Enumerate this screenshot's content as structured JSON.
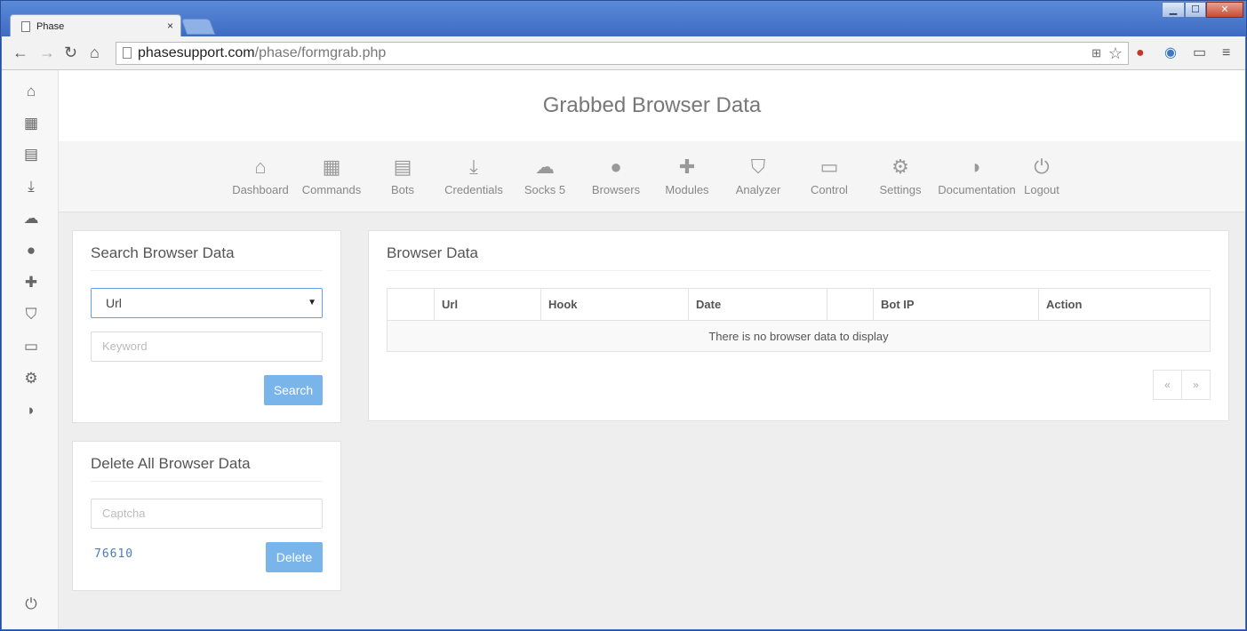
{
  "browser": {
    "tab_title": "Phase",
    "tab_close": "×",
    "window_buttons": {
      "minimize": "▁",
      "maximize": "☐",
      "close": "✕"
    },
    "url_domain": "phasesupport.com",
    "url_path": "/phase/formgrab.php",
    "nav_icons": [
      "back-icon",
      "forward-icon",
      "reload-icon",
      "home-icon"
    ],
    "toolbar_icons": [
      "translate-icon",
      "star-icon",
      "extension-cookie-icon",
      "extension-globe-icon",
      "cast-icon",
      "menu-icon"
    ]
  },
  "header": {
    "title": "Grabbed Browser Data"
  },
  "nav": {
    "items": [
      {
        "label": "Dashboard",
        "icon": "home-icon"
      },
      {
        "label": "Commands",
        "icon": "calendar-icon"
      },
      {
        "label": "Bots",
        "icon": "grid-icon"
      },
      {
        "label": "Credentials",
        "icon": "download-icon"
      },
      {
        "label": "Socks 5",
        "icon": "cloud-icon"
      },
      {
        "label": "Browsers",
        "icon": "globe-icon"
      },
      {
        "label": "Modules",
        "icon": "puzzle-icon"
      },
      {
        "label": "Analyzer",
        "icon": "shield-icon"
      },
      {
        "label": "Control",
        "icon": "monitor-icon"
      },
      {
        "label": "Settings",
        "icon": "gears-icon"
      },
      {
        "label": "Documentation",
        "icon": "chat-icon"
      },
      {
        "label": "Logout",
        "icon": "power-icon"
      }
    ]
  },
  "sidebar": {
    "icons": [
      "home-icon",
      "calendar-icon",
      "grid-icon",
      "download-icon",
      "cloud-icon",
      "globe-icon",
      "puzzle-icon",
      "shield-icon",
      "monitor-icon",
      "gears-icon",
      "chat-icon"
    ],
    "bottom_icon": "power-icon"
  },
  "search_panel": {
    "title": "Search Browser Data",
    "select_value": "Url",
    "keyword_placeholder": "Keyword",
    "search_label": "Search"
  },
  "delete_panel": {
    "title": "Delete All Browser Data",
    "captcha_placeholder": "Captcha",
    "captcha_code": "76610",
    "delete_label": "Delete"
  },
  "data_panel": {
    "title": "Browser Data",
    "columns": [
      "",
      "Url",
      "Hook",
      "Date",
      "",
      "Bot IP",
      "Action"
    ],
    "empty_message": "There is no browser data to display",
    "pager_prev": "«",
    "pager_next": "»"
  },
  "colors": {
    "accent": "#79b4ea",
    "chrome_frame": "#3f6fc6"
  }
}
